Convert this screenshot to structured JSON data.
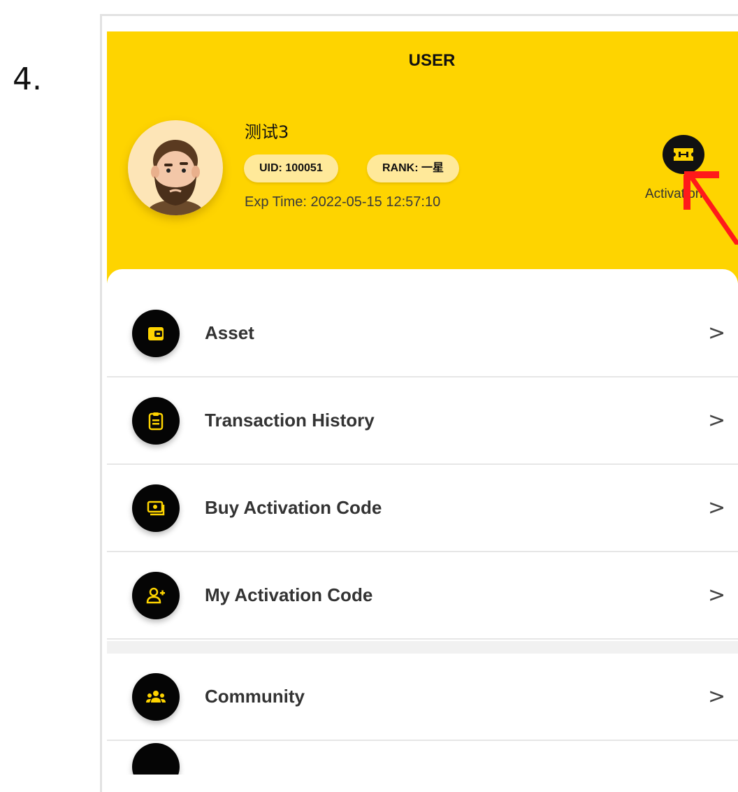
{
  "step_number": "4.",
  "header": {
    "title": "USER",
    "username": "测试3",
    "uid_badge": "UID: 100051",
    "rank_badge": "RANK: 一星",
    "exp_time": "Exp Time: 2022-05-15 12:57:10",
    "activation_label": "Activation",
    "accent_color": "#fed400"
  },
  "menu": {
    "items": [
      {
        "label": "Asset",
        "icon": "wallet-icon"
      },
      {
        "label": "Transaction History",
        "icon": "clipboard-icon"
      },
      {
        "label": "Buy Activation Code",
        "icon": "money-icon"
      },
      {
        "label": "My Activation Code",
        "icon": "add-user-icon"
      },
      {
        "label": "Community",
        "icon": "group-icon"
      }
    ],
    "chevron": ">"
  },
  "annotation": {
    "arrow_color": "#ff1a1a"
  }
}
